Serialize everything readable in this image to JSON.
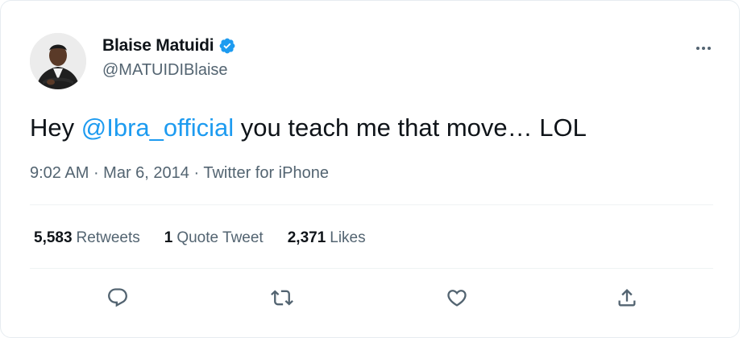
{
  "tweet": {
    "author": {
      "name": "Blaise Matuidi",
      "handle": "@MATUIDIBlaise",
      "verified": true
    },
    "text_before": "Hey ",
    "mention": "@Ibra_official",
    "text_after": " you teach me that move… LOL",
    "meta": {
      "time": "9:02 AM",
      "date": "Mar 6, 2014",
      "source": "Twitter for iPhone",
      "separator": "·"
    },
    "stats": {
      "retweets_count": "5,583",
      "retweets_label": "Retweets",
      "quotes_count": "1",
      "quotes_label": "Quote Tweet",
      "likes_count": "2,371",
      "likes_label": "Likes"
    }
  },
  "icons": {
    "more": "more-horizontal-icon",
    "reply": "reply-icon",
    "retweet": "retweet-icon",
    "like": "heart-icon",
    "share": "share-icon",
    "verified": "verified-badge-icon"
  },
  "colors": {
    "accent": "#1d9bf0",
    "text_primary": "#0f1419",
    "text_secondary": "#536471",
    "divider": "#eff3f4"
  }
}
